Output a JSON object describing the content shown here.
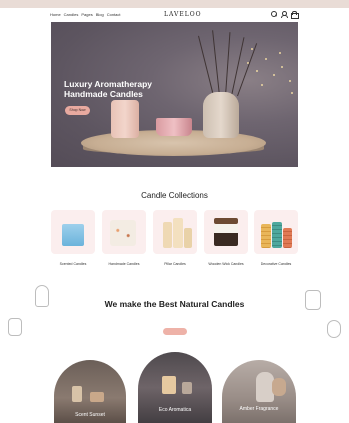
{
  "announcement": "",
  "header": {
    "nav": [
      "Home",
      "Candles",
      "Pages",
      "Blog",
      "Contact"
    ],
    "logo": "LAVELOO",
    "icons": [
      "search-icon",
      "user-icon",
      "bag-icon"
    ]
  },
  "hero": {
    "kicker": "",
    "title": "Luxury Aromatherapy Handmade Candles",
    "button": "Shop Now"
  },
  "collections": {
    "kicker": "",
    "title": "Candle Collections",
    "items": [
      {
        "name": "Scented Candles",
        "count": ""
      },
      {
        "name": "Handmade Candles",
        "count": ""
      },
      {
        "name": "Pillar Candles",
        "count": ""
      },
      {
        "name": "Wooden Wick Candles",
        "count": ""
      },
      {
        "name": "Decorative Candles",
        "count": ""
      }
    ]
  },
  "about": {
    "kicker": "",
    "title": "We make the Best Natural Candles",
    "text": "",
    "button": ""
  },
  "cards": [
    {
      "title": "Scent Sunset",
      "sub": ""
    },
    {
      "title": "Eco Aromatica",
      "sub": ""
    },
    {
      "title": "Amber Fragrance",
      "sub": ""
    }
  ],
  "colors": {
    "accent": "#e8aaa0",
    "hero_bg": "#5d5560",
    "tile_bg": "#fbeeee"
  }
}
